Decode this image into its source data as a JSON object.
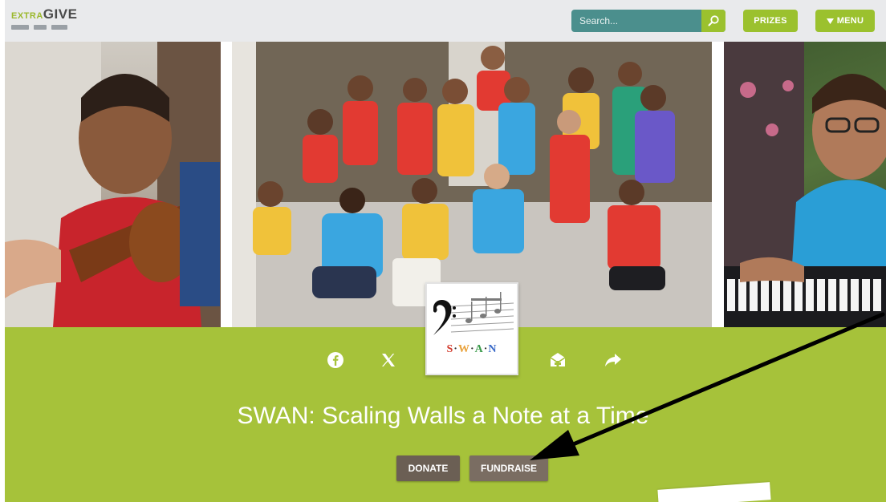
{
  "header": {
    "logo": {
      "extra": "EXTRA",
      "give": "GIVE"
    },
    "search": {
      "placeholder": "Search..."
    },
    "prizes_label": "PRIZES",
    "menu_label": "MENU"
  },
  "photos": {
    "left": "girl-violin-photo",
    "middle": "children-group-photo",
    "right": "boy-piano-photo"
  },
  "org_logo": {
    "letters": "S·W·A·N"
  },
  "social_icons": [
    "facebook-icon",
    "x-icon",
    "email-icon",
    "share-icon"
  ],
  "title": "SWAN: Scaling Walls a Note at a Time",
  "buttons": {
    "donate": "DONATE",
    "fundraise": "FUNDRAISE"
  },
  "colors": {
    "accent_green": "#9bc12e",
    "band_green": "#a6c23a",
    "search_teal": "#4b8f8d",
    "button_brown": "#6b5f54"
  }
}
